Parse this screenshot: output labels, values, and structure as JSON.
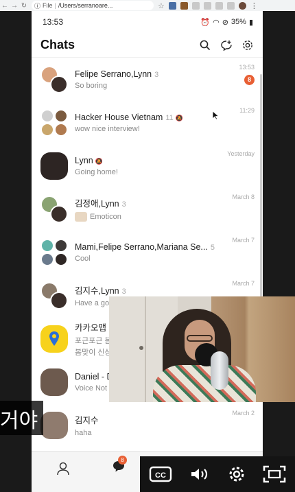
{
  "browser": {
    "file_label": "File",
    "url": "/Users/serranoare..."
  },
  "phone": {
    "status_time": "13:53",
    "battery": "35%",
    "title": "Chats"
  },
  "chats": [
    {
      "name": "Felipe Serrano,Lynn",
      "count": "3",
      "muted": false,
      "message": "So boring",
      "time": "13:53",
      "badge": "8"
    },
    {
      "name": "Hacker House Vietnam",
      "count": "11",
      "muted": true,
      "message": "wow nice interview!",
      "time": "11:29",
      "badge": ""
    },
    {
      "name": "Lynn",
      "count": "",
      "muted": true,
      "message": "Going home!",
      "time": "Yesterday",
      "badge": ""
    },
    {
      "name": "김정애,Lynn",
      "count": "3",
      "muted": false,
      "message": "Emoticon",
      "time": "March 8",
      "badge": ""
    },
    {
      "name": "Mami,Felipe Serrano,Mariana Se...",
      "count": "5",
      "muted": false,
      "message": "Cool",
      "time": "March 7",
      "badge": ""
    },
    {
      "name": "김지수,Lynn",
      "count": "3",
      "muted": false,
      "message": "Have a go",
      "time": "March 7",
      "badge": ""
    },
    {
      "name": "카카오맵",
      "count": "",
      "muted": false,
      "message": "포근포근 봄",
      "message2": "봄맞이 신상",
      "time": "",
      "badge": ""
    },
    {
      "name": "Daniel - D",
      "count": "",
      "muted": false,
      "message": "Voice Not",
      "time": "",
      "badge": ""
    },
    {
      "name": "김지수",
      "count": "",
      "muted": false,
      "message": "haha",
      "time": "March 2",
      "badge": ""
    }
  ],
  "tabbar": {
    "chat_badge": "8"
  },
  "caption": {
    "text": "거야"
  },
  "colors": {
    "accent": "#e85f34",
    "kakao_yellow": "#f7d21c",
    "map_blue": "#2b6fd6"
  },
  "icons": [
    "search-icon",
    "new-chat-icon",
    "settings-icon",
    "person-icon",
    "chat-bubble-icon",
    "cc-icon",
    "volume-icon",
    "gear-icon",
    "fullscreen-icon"
  ]
}
